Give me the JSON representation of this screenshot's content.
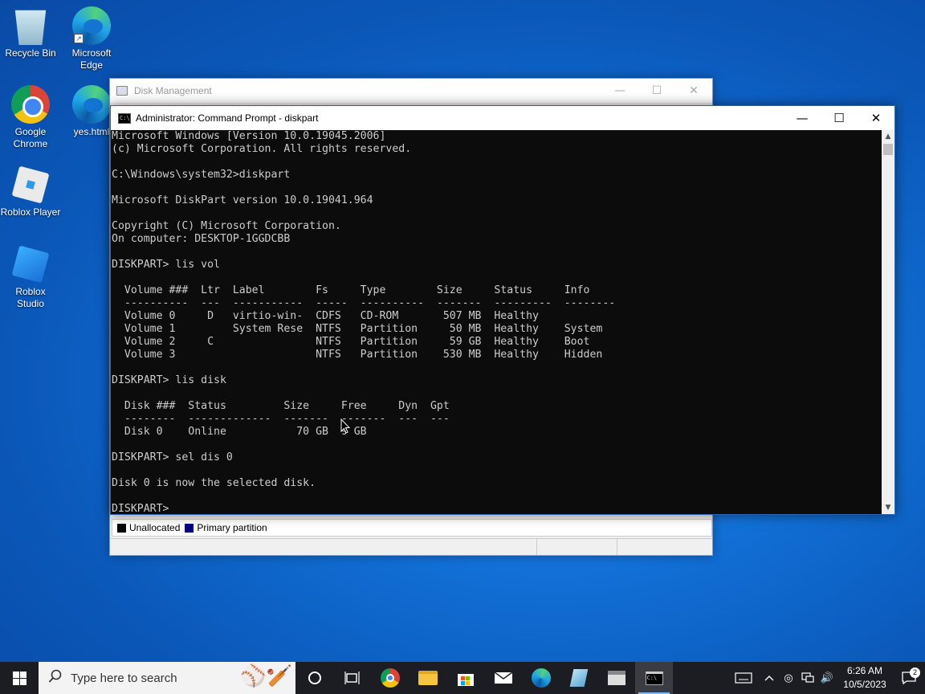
{
  "desktop": {
    "icons": [
      {
        "label": "Recycle Bin"
      },
      {
        "label": "Microsoft Edge"
      },
      {
        "label": "Google Chrome"
      },
      {
        "label": "yes.html"
      },
      {
        "label": "Roblox Player"
      },
      {
        "label": "Roblox Studio"
      }
    ]
  },
  "disk_management": {
    "title": "Disk Management",
    "legend": [
      {
        "label": "Unallocated",
        "color": "#000000"
      },
      {
        "label": "Primary partition",
        "color": "#000080"
      }
    ]
  },
  "cmd": {
    "title": "Administrator: Command Prompt - diskpart",
    "lines": [
      "Microsoft Windows [Version 10.0.19045.2006]",
      "(c) Microsoft Corporation. All rights reserved.",
      "",
      "C:\\Windows\\system32>diskpart",
      "",
      "Microsoft DiskPart version 10.0.19041.964",
      "",
      "Copyright (C) Microsoft Corporation.",
      "On computer: DESKTOP-1GGDCBB",
      "",
      "DISKPART> lis vol",
      "",
      "  Volume ###  Ltr  Label        Fs     Type        Size     Status     Info",
      "  ----------  ---  -----------  -----  ----------  -------  ---------  --------",
      "  Volume 0     D   virtio-win-  CDFS   CD-ROM       507 MB  Healthy",
      "  Volume 1         System Rese  NTFS   Partition     50 MB  Healthy    System",
      "  Volume 2     C                NTFS   Partition     59 GB  Healthy    Boot",
      "  Volume 3                      NTFS   Partition    530 MB  Healthy    Hidden",
      "",
      "DISKPART> lis disk",
      "",
      "  Disk ###  Status         Size     Free     Dyn  Gpt",
      "  --------  -------------  -------  -------  ---  ---",
      "  Disk 0    Online           70 GB  9 GB",
      "",
      "DISKPART> sel dis 0",
      "",
      "Disk 0 is now the selected disk.",
      "",
      "DISKPART> "
    ]
  },
  "taskbar": {
    "search_placeholder": "Type here to search",
    "clock_time": "6:26 AM",
    "clock_date": "10/5/2023",
    "notification_count": "2"
  }
}
